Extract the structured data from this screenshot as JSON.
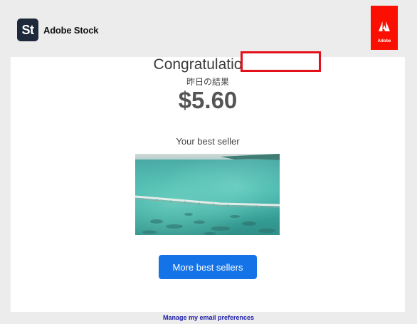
{
  "header": {
    "stock_badge": "St",
    "stock_name": "Adobe Stock",
    "adobe_label": "Adobe",
    "colors": {
      "stock_badge_bg": "#1e2a3b",
      "adobe_red": "#fa0f00"
    }
  },
  "email": {
    "greeting": "Congratulations,",
    "subtitle": "昨日の結果",
    "amount": "$5.60",
    "best_seller_label": "Your best seller",
    "best_seller_image_icon": "aerial-sea-bridge-photo",
    "more_button_label": "More best sellers",
    "redaction_color": "#e3121a"
  },
  "footer": {
    "manage_link": "Manage my email preferences"
  },
  "colors": {
    "background": "#ececec",
    "card": "#ffffff",
    "button": "#1473e6",
    "link": "#1a1aa8"
  }
}
